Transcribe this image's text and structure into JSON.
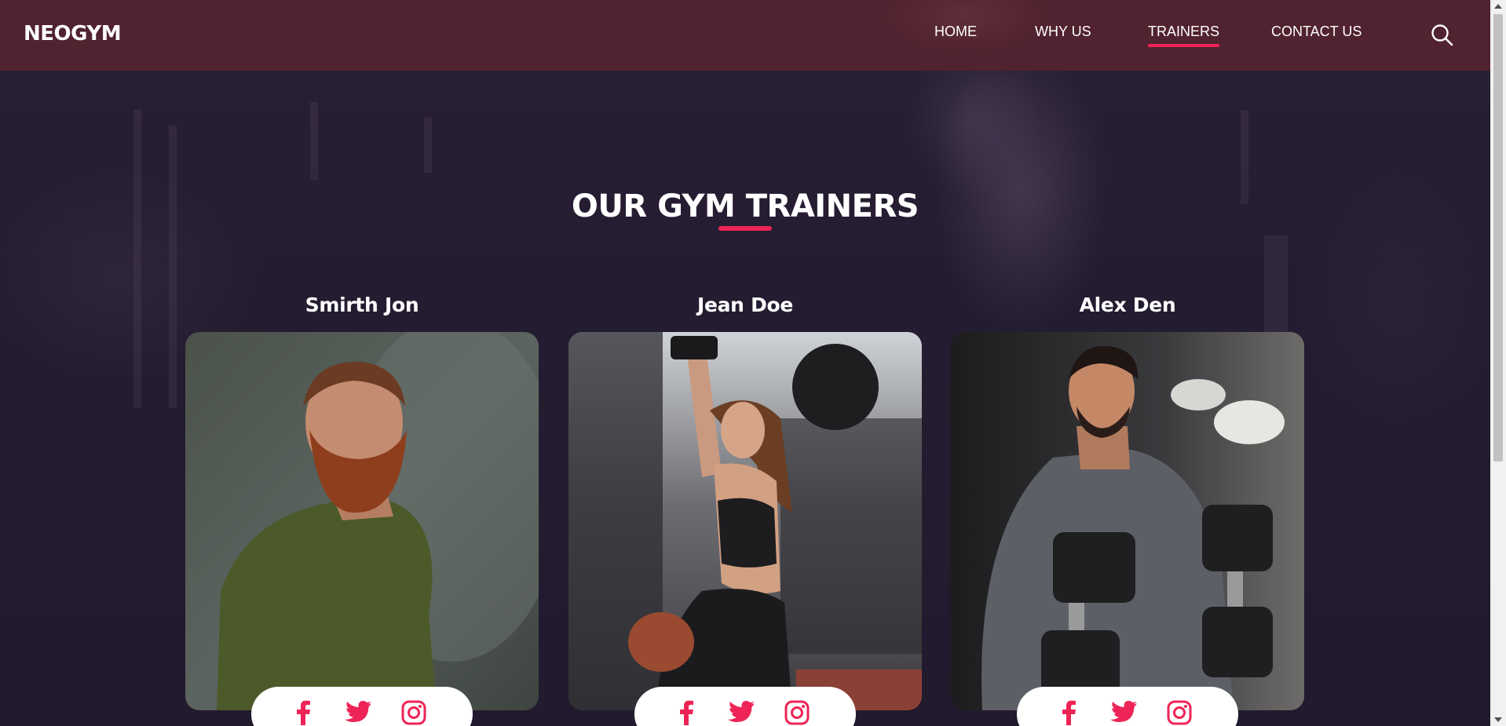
{
  "brand": {
    "logo": "NEOGYM",
    "accent": "#ee2456",
    "topbar_color": "#51222f",
    "background": "#231b2e"
  },
  "nav": {
    "items": [
      {
        "label": "HOME",
        "active": false
      },
      {
        "label": "WHY US",
        "active": false
      },
      {
        "label": "TRAINERS",
        "active": true
      },
      {
        "label": "CONTACT US",
        "active": false
      }
    ],
    "search_icon": "search-icon"
  },
  "section": {
    "title": "OUR GYM TRAINERS"
  },
  "trainers": [
    {
      "name": "Smirth Jon",
      "photo": "bearded man in green t-shirt",
      "social": [
        "facebook-icon",
        "twitter-icon",
        "instagram-icon"
      ]
    },
    {
      "name": "Jean Doe",
      "photo": "woman doing lat pulldown",
      "social": [
        "facebook-icon",
        "twitter-icon",
        "instagram-icon"
      ]
    },
    {
      "name": "Alex Den",
      "photo": "man lifting dumbbells",
      "social": [
        "facebook-icon",
        "twitter-icon",
        "instagram-icon"
      ]
    }
  ]
}
